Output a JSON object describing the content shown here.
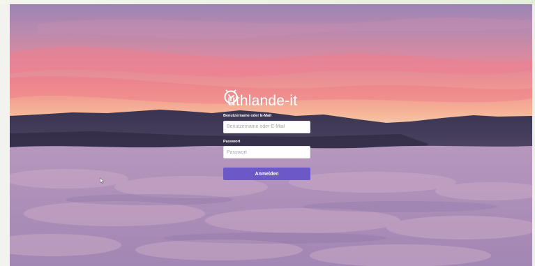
{
  "brand": {
    "name": "uthlande-it",
    "logo_icon": "compass-hand-logo-icon"
  },
  "login_form": {
    "username_label": "Benutzername oder E-Mail",
    "username_placeholder": "Benutzername oder E-Mail",
    "username_value": "",
    "password_label": "Passwort",
    "password_placeholder": "Passwort",
    "password_value": "",
    "submit_label": "Anmelden"
  },
  "colors": {
    "accent": "#6c58c6",
    "sky_top": "#9c84b4",
    "sky_glow": "#f2a091",
    "clouds": "#b998b6"
  }
}
